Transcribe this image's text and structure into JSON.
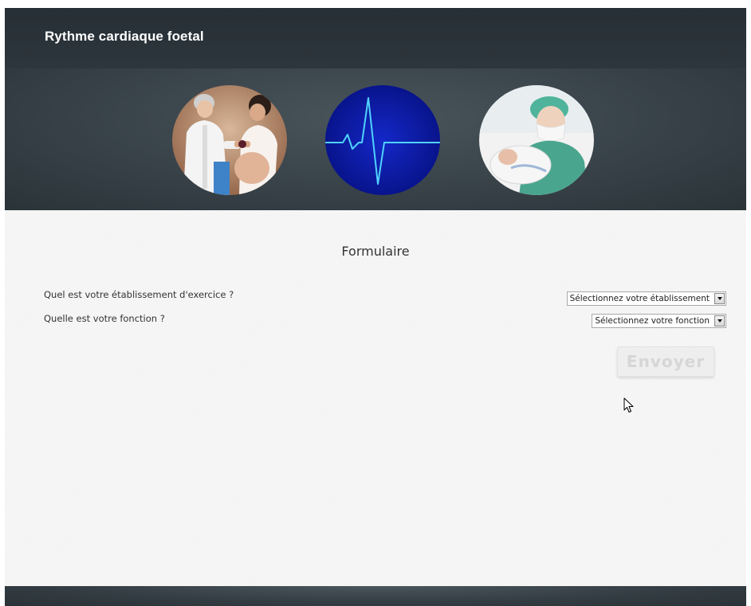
{
  "header": {
    "title": "Rythme cardiaque foetal"
  },
  "banner": {
    "images": [
      {
        "name": "doctor-pregnant-woman",
        "alt": ""
      },
      {
        "name": "heartbeat",
        "alt": ""
      },
      {
        "name": "nurse-newborn",
        "alt": ""
      }
    ]
  },
  "form": {
    "title": "Formulaire",
    "questions": [
      {
        "label": "Quel est votre établissement d'exercice ?",
        "select_value": "Sélectionnez votre établissement"
      },
      {
        "label": "Quelle est votre fonction ?",
        "select_value": "Sélectionnez votre fonction"
      }
    ],
    "submit_label": "Envoyer"
  },
  "colors": {
    "header_bg": "#262f35",
    "page_bg": "#f6f6f6",
    "heartbeat_line": "#4fd3ff",
    "heartbeat_bg": "#0a1aa0"
  }
}
